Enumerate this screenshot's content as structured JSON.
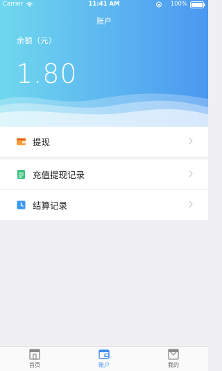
{
  "status_bar": {
    "carrier": "Carrier",
    "time": "11:41 AM",
    "battery": "100%"
  },
  "header": {
    "title": "账户",
    "balance_label": "余额（元）",
    "balance": "1.80"
  },
  "menu": [
    {
      "label": "提现",
      "icon": "wallet-icon"
    },
    {
      "label": "充值提现记录",
      "icon": "document-icon"
    },
    {
      "label": "结算记录",
      "icon": "clock-icon"
    }
  ],
  "tabbar": {
    "tabs": [
      {
        "label": "首页",
        "icon": "home-icon",
        "active": false
      },
      {
        "label": "账户",
        "icon": "wallet-icon",
        "active": true
      },
      {
        "label": "我的",
        "icon": "profile-icon",
        "active": false
      }
    ]
  },
  "colors": {
    "accent": "#3e8ef0",
    "header_start": "#6fd8ee",
    "header_end": "#4a98f0"
  }
}
